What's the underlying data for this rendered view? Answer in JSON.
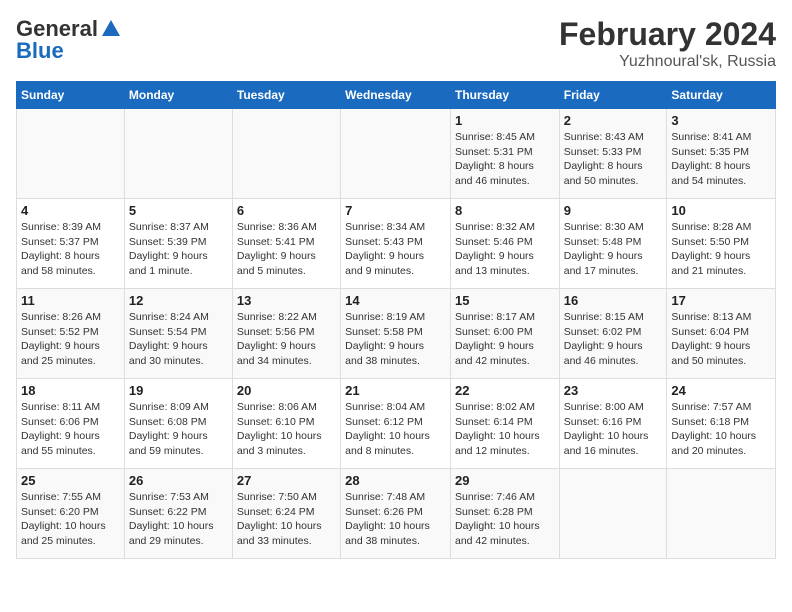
{
  "logo": {
    "line1": "General",
    "line2": "Blue"
  },
  "title": "February 2024",
  "subtitle": "Yuzhnoural'sk, Russia",
  "headers": [
    "Sunday",
    "Monday",
    "Tuesday",
    "Wednesday",
    "Thursday",
    "Friday",
    "Saturday"
  ],
  "weeks": [
    [
      {
        "day": "",
        "info": ""
      },
      {
        "day": "",
        "info": ""
      },
      {
        "day": "",
        "info": ""
      },
      {
        "day": "",
        "info": ""
      },
      {
        "day": "1",
        "info": "Sunrise: 8:45 AM\nSunset: 5:31 PM\nDaylight: 8 hours\nand 46 minutes."
      },
      {
        "day": "2",
        "info": "Sunrise: 8:43 AM\nSunset: 5:33 PM\nDaylight: 8 hours\nand 50 minutes."
      },
      {
        "day": "3",
        "info": "Sunrise: 8:41 AM\nSunset: 5:35 PM\nDaylight: 8 hours\nand 54 minutes."
      }
    ],
    [
      {
        "day": "4",
        "info": "Sunrise: 8:39 AM\nSunset: 5:37 PM\nDaylight: 8 hours\nand 58 minutes."
      },
      {
        "day": "5",
        "info": "Sunrise: 8:37 AM\nSunset: 5:39 PM\nDaylight: 9 hours\nand 1 minute."
      },
      {
        "day": "6",
        "info": "Sunrise: 8:36 AM\nSunset: 5:41 PM\nDaylight: 9 hours\nand 5 minutes."
      },
      {
        "day": "7",
        "info": "Sunrise: 8:34 AM\nSunset: 5:43 PM\nDaylight: 9 hours\nand 9 minutes."
      },
      {
        "day": "8",
        "info": "Sunrise: 8:32 AM\nSunset: 5:46 PM\nDaylight: 9 hours\nand 13 minutes."
      },
      {
        "day": "9",
        "info": "Sunrise: 8:30 AM\nSunset: 5:48 PM\nDaylight: 9 hours\nand 17 minutes."
      },
      {
        "day": "10",
        "info": "Sunrise: 8:28 AM\nSunset: 5:50 PM\nDaylight: 9 hours\nand 21 minutes."
      }
    ],
    [
      {
        "day": "11",
        "info": "Sunrise: 8:26 AM\nSunset: 5:52 PM\nDaylight: 9 hours\nand 25 minutes."
      },
      {
        "day": "12",
        "info": "Sunrise: 8:24 AM\nSunset: 5:54 PM\nDaylight: 9 hours\nand 30 minutes."
      },
      {
        "day": "13",
        "info": "Sunrise: 8:22 AM\nSunset: 5:56 PM\nDaylight: 9 hours\nand 34 minutes."
      },
      {
        "day": "14",
        "info": "Sunrise: 8:19 AM\nSunset: 5:58 PM\nDaylight: 9 hours\nand 38 minutes."
      },
      {
        "day": "15",
        "info": "Sunrise: 8:17 AM\nSunset: 6:00 PM\nDaylight: 9 hours\nand 42 minutes."
      },
      {
        "day": "16",
        "info": "Sunrise: 8:15 AM\nSunset: 6:02 PM\nDaylight: 9 hours\nand 46 minutes."
      },
      {
        "day": "17",
        "info": "Sunrise: 8:13 AM\nSunset: 6:04 PM\nDaylight: 9 hours\nand 50 minutes."
      }
    ],
    [
      {
        "day": "18",
        "info": "Sunrise: 8:11 AM\nSunset: 6:06 PM\nDaylight: 9 hours\nand 55 minutes."
      },
      {
        "day": "19",
        "info": "Sunrise: 8:09 AM\nSunset: 6:08 PM\nDaylight: 9 hours\nand 59 minutes."
      },
      {
        "day": "20",
        "info": "Sunrise: 8:06 AM\nSunset: 6:10 PM\nDaylight: 10 hours\nand 3 minutes."
      },
      {
        "day": "21",
        "info": "Sunrise: 8:04 AM\nSunset: 6:12 PM\nDaylight: 10 hours\nand 8 minutes."
      },
      {
        "day": "22",
        "info": "Sunrise: 8:02 AM\nSunset: 6:14 PM\nDaylight: 10 hours\nand 12 minutes."
      },
      {
        "day": "23",
        "info": "Sunrise: 8:00 AM\nSunset: 6:16 PM\nDaylight: 10 hours\nand 16 minutes."
      },
      {
        "day": "24",
        "info": "Sunrise: 7:57 AM\nSunset: 6:18 PM\nDaylight: 10 hours\nand 20 minutes."
      }
    ],
    [
      {
        "day": "25",
        "info": "Sunrise: 7:55 AM\nSunset: 6:20 PM\nDaylight: 10 hours\nand 25 minutes."
      },
      {
        "day": "26",
        "info": "Sunrise: 7:53 AM\nSunset: 6:22 PM\nDaylight: 10 hours\nand 29 minutes."
      },
      {
        "day": "27",
        "info": "Sunrise: 7:50 AM\nSunset: 6:24 PM\nDaylight: 10 hours\nand 33 minutes."
      },
      {
        "day": "28",
        "info": "Sunrise: 7:48 AM\nSunset: 6:26 PM\nDaylight: 10 hours\nand 38 minutes."
      },
      {
        "day": "29",
        "info": "Sunrise: 7:46 AM\nSunset: 6:28 PM\nDaylight: 10 hours\nand 42 minutes."
      },
      {
        "day": "",
        "info": ""
      },
      {
        "day": "",
        "info": ""
      }
    ]
  ]
}
